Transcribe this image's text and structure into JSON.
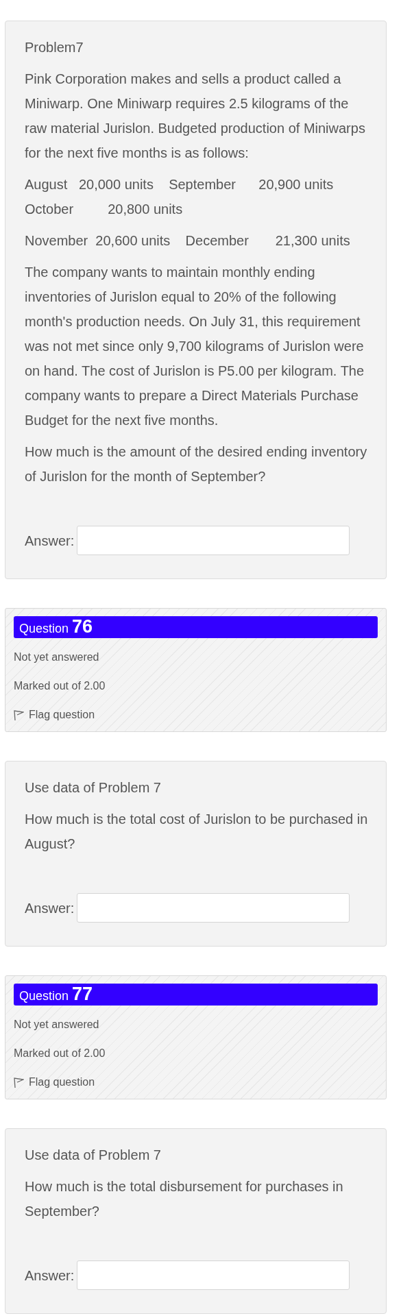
{
  "blocks": [
    {
      "kind": "content",
      "paragraphs": [
        "Problem7",
        "Pink Corporation makes and sells a product called a Miniwarp. One Miniwarp requires 2.5 kilograms of the raw material Jurislon. Budgeted production of Miniwarps for the next five months is as follows:",
        "August   20,000 units    September      20,900 units        October         20,800 units",
        "November  20,600 units    December       21,300 units",
        "The company wants to maintain monthly ending inventories of Jurislon equal to 20% of the following month's production needs. On July 31, this requirement was not met since only 9,700 kilograms of Jurislon were on hand. The cost of Jurislon is P5.00 per kilogram. The company wants to prepare a Direct Materials Purchase Budget for the next five months.",
        "How much is the amount of the desired ending inventory of Jurislon for the month of September?"
      ],
      "answer_label": "Answer:"
    },
    {
      "kind": "info",
      "label": "Question",
      "number": "76",
      "status": "Not yet answered",
      "marks": "Marked out of 2.00",
      "flag": "Flag question"
    },
    {
      "kind": "content",
      "paragraphs": [
        "Use data of Problem 7",
        "How much is the total cost of Jurislon to be purchased in August?"
      ],
      "answer_label": "Answer:"
    },
    {
      "kind": "info",
      "label": "Question",
      "number": "77",
      "status": "Not yet answered",
      "marks": "Marked out of 2.00",
      "flag": "Flag question"
    },
    {
      "kind": "content",
      "paragraphs": [
        "Use data of Problem 7",
        "How much is the total disbursement for purchases in September?"
      ],
      "answer_label": "Answer:"
    }
  ]
}
